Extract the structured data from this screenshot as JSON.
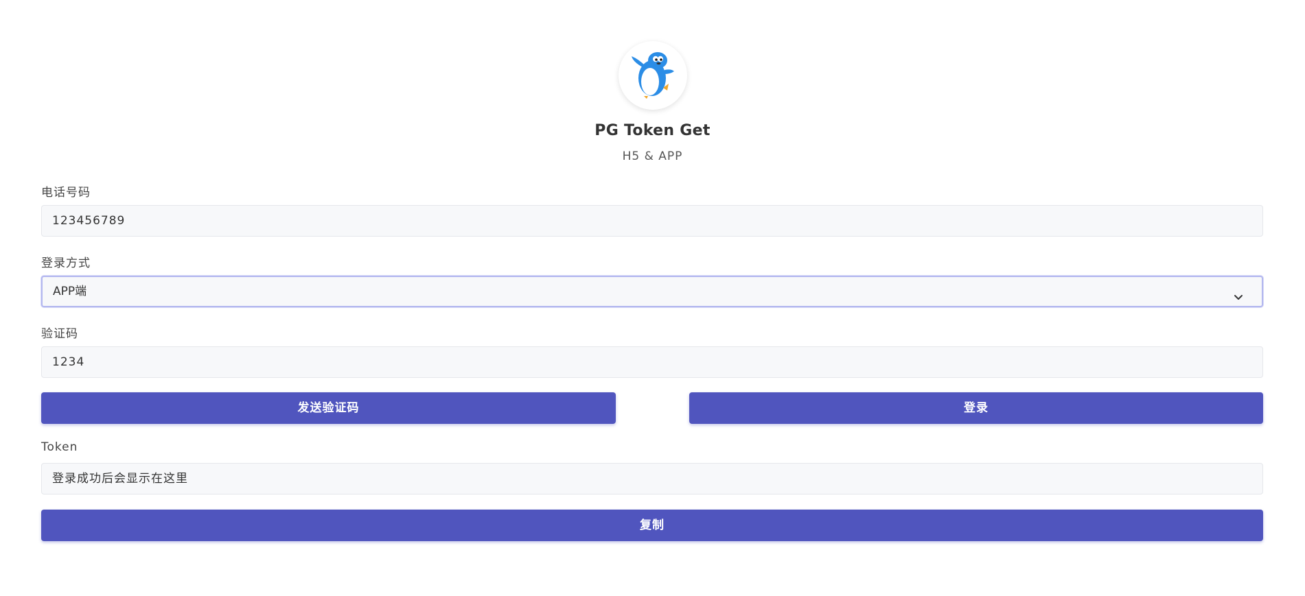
{
  "header": {
    "title": "PG Token Get",
    "subtitle": "H5 & APP"
  },
  "form": {
    "phone": {
      "label": "电话号码",
      "value": "123456789"
    },
    "login_method": {
      "label": "登录方式",
      "selected": "APP端"
    },
    "code": {
      "label": "验证码",
      "value": "1234"
    },
    "send_code_button": "发送验证码",
    "login_button": "登录",
    "token": {
      "label": "Token",
      "placeholder": "登录成功后会显示在这里"
    },
    "copy_button": "复制"
  },
  "colors": {
    "primary": "#5055be",
    "input_bg": "#f7f8fa",
    "logo_blue": "#2b8de6"
  },
  "icons": {
    "logo": "penguin-icon",
    "select_arrow": "chevron-down-icon"
  }
}
